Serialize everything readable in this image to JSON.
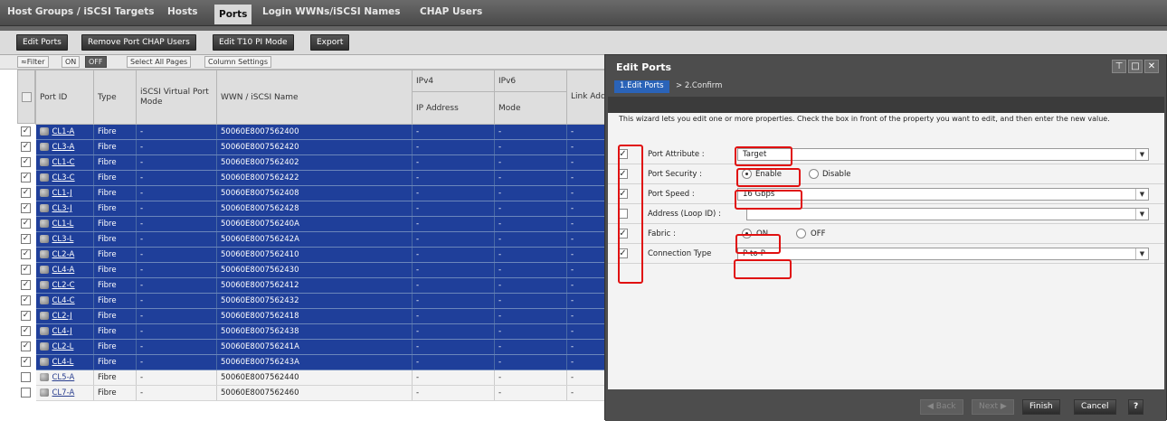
{
  "tabs": {
    "host_groups": "Host Groups / iSCSI Targets",
    "hosts": "Hosts",
    "ports": "Ports",
    "login": "Login WWNs/iSCSI Names",
    "chap": "CHAP Users"
  },
  "toolbar": {
    "edit_ports": "Edit Ports",
    "remove_chap": "Remove Port CHAP Users",
    "edit_t10": "Edit T10 PI Mode",
    "export": "Export"
  },
  "filterbar": {
    "filter": "≈Filter",
    "on": "ON",
    "off": "OFF",
    "select_all": "Select All Pages",
    "column_settings": "Column Settings"
  },
  "table": {
    "headers": {
      "port_id": "Port ID",
      "type": "Type",
      "iscsi_virtual": "iSCSI Virtual Port Mode",
      "wwn": "WWN / iSCSI Name",
      "ipv4": "IPv4",
      "ipv6": "IPv6",
      "ip_address": "IP Address",
      "mode": "Mode",
      "link": "Link Add"
    },
    "rows": [
      {
        "port": "CL1-A",
        "type": "Fibre",
        "vmode": "-",
        "wwn": "50060E8007562400",
        "ip": "-",
        "mode": "-",
        "link": "-"
      },
      {
        "port": "CL3-A",
        "type": "Fibre",
        "vmode": "-",
        "wwn": "50060E8007562420",
        "ip": "-",
        "mode": "-",
        "link": "-"
      },
      {
        "port": "CL1-C",
        "type": "Fibre",
        "vmode": "-",
        "wwn": "50060E8007562402",
        "ip": "-",
        "mode": "-",
        "link": "-"
      },
      {
        "port": "CL3-C",
        "type": "Fibre",
        "vmode": "-",
        "wwn": "50060E8007562422",
        "ip": "-",
        "mode": "-",
        "link": "-"
      },
      {
        "port": "CL1-J",
        "type": "Fibre",
        "vmode": "-",
        "wwn": "50060E8007562408",
        "ip": "-",
        "mode": "-",
        "link": "-"
      },
      {
        "port": "CL3-J",
        "type": "Fibre",
        "vmode": "-",
        "wwn": "50060E8007562428",
        "ip": "-",
        "mode": "-",
        "link": "-"
      },
      {
        "port": "CL1-L",
        "type": "Fibre",
        "vmode": "-",
        "wwn": "50060E800756240A",
        "ip": "-",
        "mode": "-",
        "link": "-"
      },
      {
        "port": "CL3-L",
        "type": "Fibre",
        "vmode": "-",
        "wwn": "50060E800756242A",
        "ip": "-",
        "mode": "-",
        "link": "-"
      },
      {
        "port": "CL2-A",
        "type": "Fibre",
        "vmode": "-",
        "wwn": "50060E8007562410",
        "ip": "-",
        "mode": "-",
        "link": "-"
      },
      {
        "port": "CL4-A",
        "type": "Fibre",
        "vmode": "-",
        "wwn": "50060E8007562430",
        "ip": "-",
        "mode": "-",
        "link": "-"
      },
      {
        "port": "CL2-C",
        "type": "Fibre",
        "vmode": "-",
        "wwn": "50060E8007562412",
        "ip": "-",
        "mode": "-",
        "link": "-"
      },
      {
        "port": "CL4-C",
        "type": "Fibre",
        "vmode": "-",
        "wwn": "50060E8007562432",
        "ip": "-",
        "mode": "-",
        "link": "-"
      },
      {
        "port": "CL2-J",
        "type": "Fibre",
        "vmode": "-",
        "wwn": "50060E8007562418",
        "ip": "-",
        "mode": "-",
        "link": "-"
      },
      {
        "port": "CL4-J",
        "type": "Fibre",
        "vmode": "-",
        "wwn": "50060E8007562438",
        "ip": "-",
        "mode": "-",
        "link": "-"
      },
      {
        "port": "CL2-L",
        "type": "Fibre",
        "vmode": "-",
        "wwn": "50060E800756241A",
        "ip": "-",
        "mode": "-",
        "link": "-"
      },
      {
        "port": "CL4-L",
        "type": "Fibre",
        "vmode": "-",
        "wwn": "50060E800756243A",
        "ip": "-",
        "mode": "-",
        "link": "-"
      },
      {
        "port": "CL5-A",
        "type": "Fibre",
        "vmode": "-",
        "wwn": "50060E8007562440",
        "ip": "-",
        "mode": "-",
        "link": "-"
      },
      {
        "port": "CL7-A",
        "type": "Fibre",
        "vmode": "-",
        "wwn": "50060E8007562460",
        "ip": "-",
        "mode": "-",
        "link": "-"
      }
    ],
    "selected_count": 16
  },
  "dialog": {
    "title": "Edit Ports",
    "step1": "1.Edit Ports",
    "step2": ">  2.Confirm",
    "intro": "This wizard lets you edit one or more properties. Check the  box in front of the property you want to edit, and then enter the new value.",
    "port_attribute_label": "Port Attribute :",
    "port_attribute_value": "Target",
    "port_security_label": "Port Security :",
    "port_security_enable": "Enable",
    "port_security_disable": "Disable",
    "port_speed_label": "Port Speed :",
    "port_speed_value": "16 Gbps",
    "address_label": "Address (Loop ID) :",
    "address_value": "",
    "fabric_label": "Fabric :",
    "fabric_on": "ON",
    "fabric_off": "OFF",
    "connection_label": "Connection Type",
    "connection_value": "P-to-P",
    "back": "◀ Back",
    "next": "Next ▶",
    "finish": "Finish",
    "cancel": "Cancel",
    "help": "?"
  },
  "colors": {
    "selected_row": "#1f3f9a",
    "highlight": "#e01010",
    "step_active": "#2a63b8"
  }
}
